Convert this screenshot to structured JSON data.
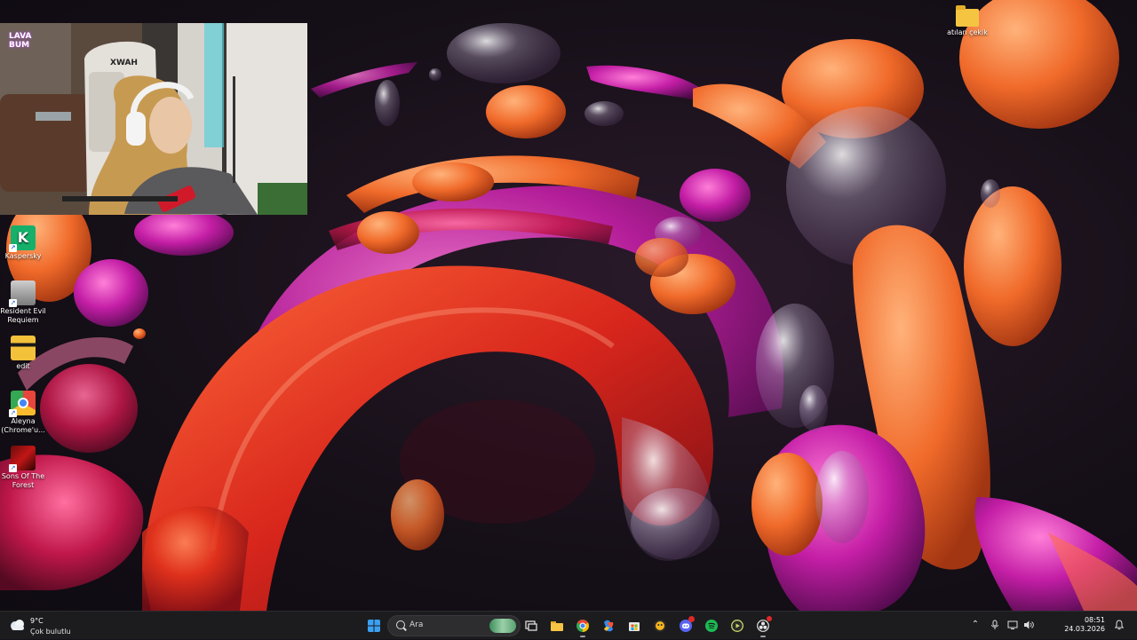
{
  "desktop": {
    "icons": [
      {
        "name": "Kasper­sky",
        "label": "Kaspersky"
      },
      {
        "label": "Resident Evil Requiem"
      },
      {
        "label": "edit"
      },
      {
        "label": "Aleyna (Chrome'u..."
      },
      {
        "label": "Sons Of The Forest"
      },
      {
        "label": "atılan çekik"
      }
    ]
  },
  "webcam": {
    "logo_text": "LAVA BUM",
    "chair_text": "XWAH"
  },
  "taskbar": {
    "weather": {
      "temp": "9°C",
      "condition": "Çok bulutlu"
    },
    "search": {
      "placeholder": "Ara"
    },
    "apps": [
      {
        "icon": "windows-start-icon"
      },
      {
        "icon": "search-icon"
      },
      {
        "icon": "task-view-icon"
      },
      {
        "icon": "file-explorer-icon"
      },
      {
        "icon": "chrome-icon"
      },
      {
        "icon": "copilot-icon"
      },
      {
        "icon": "store-icon"
      },
      {
        "icon": "game-bar-icon"
      },
      {
        "icon": "discord-icon"
      },
      {
        "icon": "spotify-icon"
      },
      {
        "icon": "media-player-icon"
      },
      {
        "icon": "obs-icon"
      }
    ],
    "clock": {
      "time": "08:51",
      "date": "24.03.2026"
    },
    "colors": {
      "taskbar_bg": "#1c1c1e",
      "accent": "#0078d4",
      "spotify": "#1db954",
      "discord": "#5865f2"
    }
  }
}
